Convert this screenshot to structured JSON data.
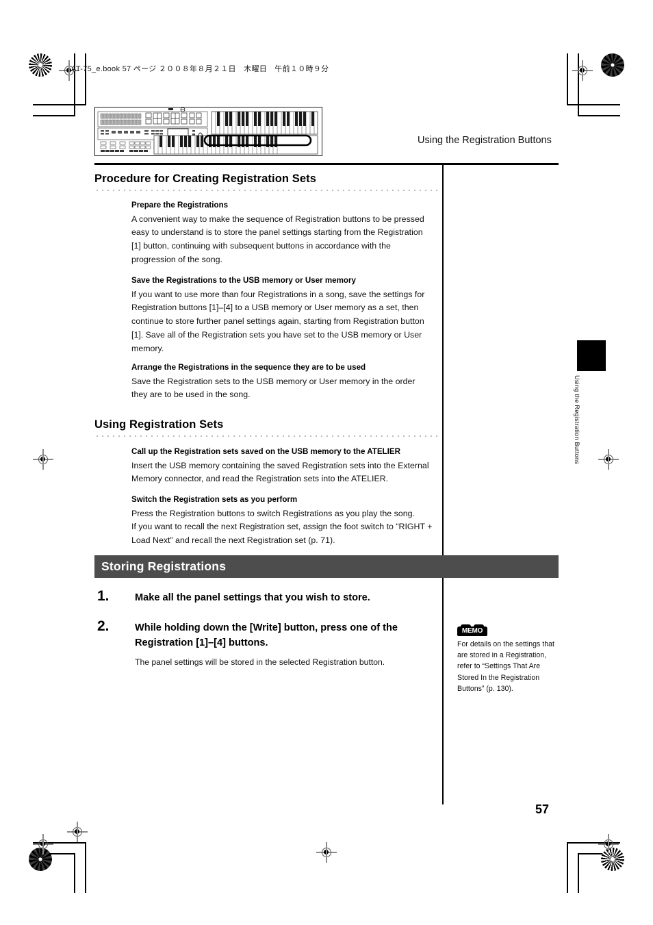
{
  "print_header": "AT-75_e.book  57 ページ  ２００８年８月２１日　木曜日　午前１０時９分",
  "running_head": "Using the Registration Buttons",
  "figure": {
    "name": "atelier-organ-panel-illustration",
    "caption": ""
  },
  "sections": [
    {
      "heading": "Procedure for Creating Registration Sets",
      "blocks": [
        {
          "subheading": "Prepare the Registrations",
          "paragraphs": [
            "A convenient way to make the sequence of Registration buttons to be pressed easy to understand is to store the panel settings starting from the Registration [1] button, continuing with subsequent buttons in accordance with the progression of the song."
          ]
        },
        {
          "subheading": "Save the Registrations to the USB memory or User memory",
          "paragraphs": [
            "If you want to use more than four Registrations in a song, save the settings for Registration buttons [1]–[4] to a USB memory or User memory as a set, then continue to store further panel settings again, starting from Registration button [1]. Save all of the Registration sets you have set to the USB memory or User memory."
          ]
        },
        {
          "subheading": "Arrange the Registrations in the sequence they are to be used",
          "paragraphs": [
            "Save the Registration sets to the USB memory or User memory in the order they are to be used in the song."
          ]
        }
      ]
    },
    {
      "heading": "Using Registration Sets",
      "blocks": [
        {
          "subheading": "Call up the Registration sets saved on the USB memory to the ATELIER",
          "paragraphs": [
            "Insert the USB memory containing the saved Registration sets into the External Memory connector, and read the Registration sets into the ATELIER."
          ]
        },
        {
          "subheading": "Switch the Registration sets as you perform",
          "paragraphs": [
            "Press the Registration buttons to switch Registrations as you play the song.",
            "If you want to recall the next Registration set, assign the foot switch to “RIGHT + Load Next” and recall the next Registration set (p. 71)."
          ]
        }
      ]
    }
  ],
  "banner": {
    "title": "Storing Registrations",
    "color": "#4d4d4d",
    "text_color": "#ffffff"
  },
  "steps": [
    {
      "number": "1.",
      "heading": "Make all the panel settings that you wish to store.",
      "subtext": ""
    },
    {
      "number": "2.",
      "heading": "While holding down the [Write] button, press one of the Registration [1]–[4] buttons.",
      "subtext": "The panel settings will be stored in the selected Registration button."
    }
  ],
  "memo": {
    "icon_label": "MEMO",
    "text": "For details on the settings that are stored in a Registration, refer to “Settings That Are Stored In the Registration Buttons” (p. 130)."
  },
  "side_tab": {
    "label": "Using the Registration Buttons"
  },
  "page_number": "57"
}
